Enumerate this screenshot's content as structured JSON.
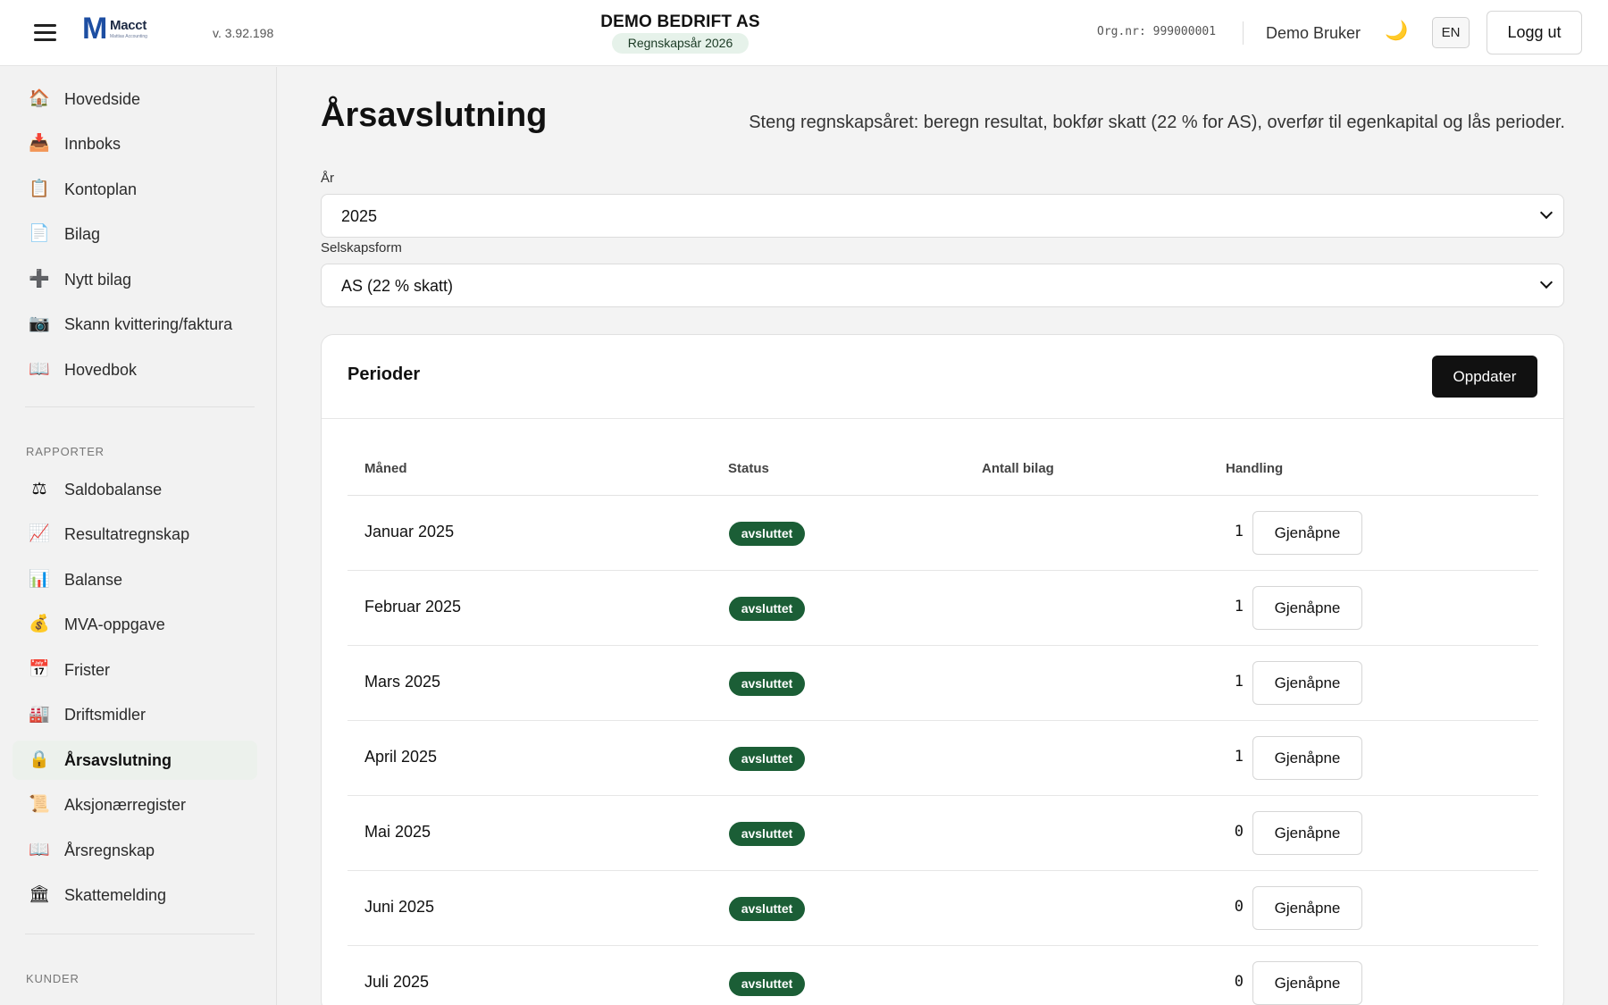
{
  "header": {
    "version": "v. 3.92.198",
    "logo": {
      "mark": "M",
      "name": "Macct",
      "tagline": "Mattias Accounting"
    },
    "company": "DEMO BEDRIFT AS",
    "fiscal_year_badge": "Regnskapsår 2026",
    "org_nr": "Org.nr: 999000001",
    "user": "Demo Bruker",
    "theme_icon": "moon-icon",
    "lang_label": "EN",
    "logout_label": "Logg ut"
  },
  "sidebar": {
    "items": [
      {
        "label": "Hovedside",
        "icon": "🏠"
      },
      {
        "label": "Innboks",
        "icon": "📥"
      },
      {
        "label": "Kontoplan",
        "icon": "📋"
      },
      {
        "label": "Bilag",
        "icon": "📄"
      },
      {
        "label": "Nytt bilag",
        "icon": "➕"
      },
      {
        "label": "Skann kvittering/faktura",
        "icon": "📷"
      },
      {
        "label": "Hovedbok",
        "icon": "📖"
      }
    ],
    "reports_heading": "RAPPORTER",
    "report_items": [
      {
        "label": "Saldobalanse",
        "icon": "⚖"
      },
      {
        "label": "Resultatregnskap",
        "icon": "📈"
      },
      {
        "label": "Balanse",
        "icon": "📊"
      },
      {
        "label": "MVA-oppgave",
        "icon": "💰"
      },
      {
        "label": "Frister",
        "icon": "📅"
      },
      {
        "label": "Driftsmidler",
        "icon": "🏭"
      },
      {
        "label": "Årsavslutning",
        "icon": "🔒",
        "active": true
      },
      {
        "label": "Aksjonærregister",
        "icon": "📜"
      },
      {
        "label": "Årsregnskap",
        "icon": "📖"
      },
      {
        "label": "Skattemelding",
        "icon": "🏛"
      }
    ],
    "customers_heading": "KUNDER"
  },
  "main": {
    "title": "Årsavslutning",
    "description": "Steng regnskapsåret: beregn resultat, bokfør skatt (22 % for AS), overfør til egenkapital og lås perioder.",
    "year_label": "År",
    "year_value": "2025",
    "company_form_label": "Selskapsform",
    "company_form_value": "AS (22 % skatt)",
    "periods": {
      "title": "Perioder",
      "refresh_label": "Oppdater",
      "columns": [
        "Måned",
        "Status",
        "Antall bilag",
        "Handling"
      ],
      "rows": [
        {
          "month": "Januar 2025",
          "status": "avsluttet",
          "count": "1",
          "action": "Gjenåpne"
        },
        {
          "month": "Februar 2025",
          "status": "avsluttet",
          "count": "1",
          "action": "Gjenåpne"
        },
        {
          "month": "Mars 2025",
          "status": "avsluttet",
          "count": "1",
          "action": "Gjenåpne"
        },
        {
          "month": "April 2025",
          "status": "avsluttet",
          "count": "1",
          "action": "Gjenåpne"
        },
        {
          "month": "Mai 2025",
          "status": "avsluttet",
          "count": "0",
          "action": "Gjenåpne"
        },
        {
          "month": "Juni 2025",
          "status": "avsluttet",
          "count": "0",
          "action": "Gjenåpne"
        },
        {
          "month": "Juli 2025",
          "status": "avsluttet",
          "count": "0",
          "action": "Gjenåpne"
        }
      ]
    }
  },
  "colors": {
    "status_badge": "#1b5e36",
    "primary_button": "#111111",
    "logo_blue": "#1d4ea2",
    "year_badge_bg": "#e6f2ea"
  }
}
